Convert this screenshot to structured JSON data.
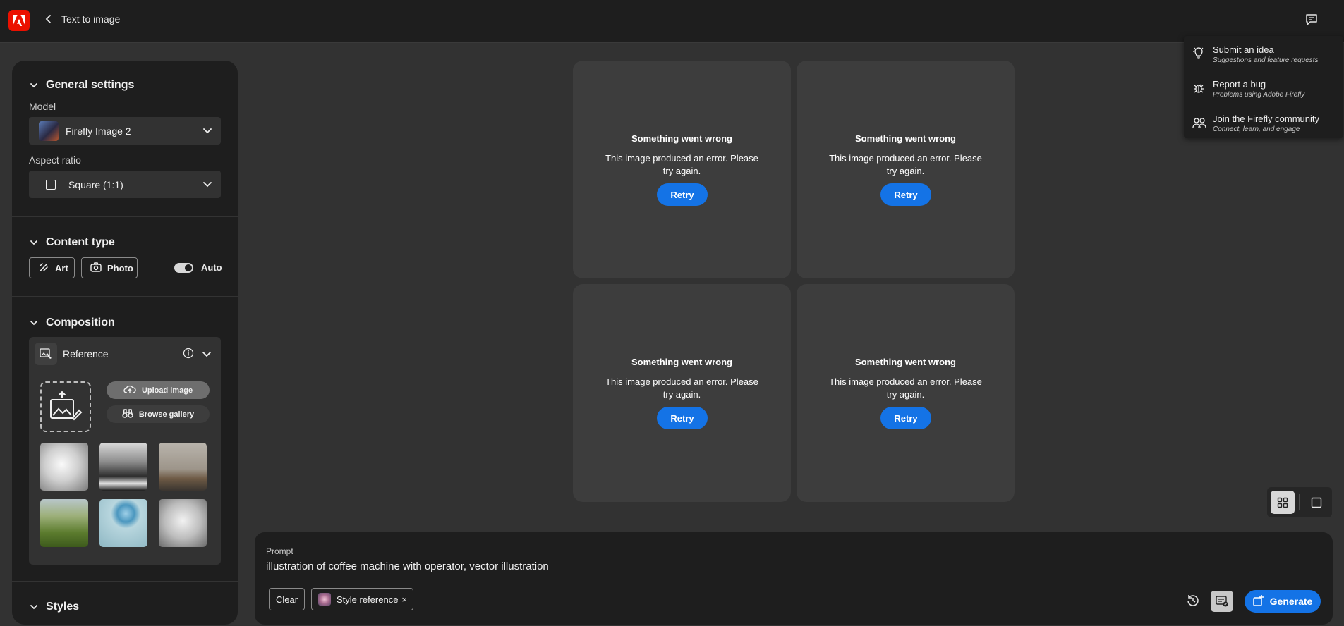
{
  "app": {
    "title": "Text to image",
    "colors": {
      "brand": "#eb1000",
      "accent": "#1473e6",
      "background": "#323232",
      "panel": "#1e1e1e"
    }
  },
  "header": {
    "back_icon": "chevron-left-icon",
    "feedback_icon": "comment-icon"
  },
  "sidebar": {
    "general": {
      "title": "General settings",
      "model_label": "Model",
      "model_value": "Firefly Image 2",
      "aspect_label": "Aspect ratio",
      "aspect_value": "Square (1:1)"
    },
    "content_type": {
      "title": "Content type",
      "art_label": "Art",
      "photo_label": "Photo",
      "auto_label": "Auto",
      "auto_on": true
    },
    "composition": {
      "title": "Composition",
      "reference_label": "Reference",
      "upload_label": "Upload image",
      "browse_label": "Browse gallery",
      "thumbnails": [
        "bird-sketch",
        "mountain-river",
        "living-room",
        "green-field-road",
        "sphere-on-block",
        "owl-sketch"
      ]
    },
    "styles": {
      "title": "Styles"
    }
  },
  "results": {
    "cards": [
      {
        "title": "Something went wrong",
        "message": "This image produced an error. Please try again.",
        "retry": "Retry"
      },
      {
        "title": "Something went wrong",
        "message": "This image produced an error. Please try again.",
        "retry": "Retry"
      },
      {
        "title": "Something went wrong",
        "message": "This image produced an error. Please try again.",
        "retry": "Retry"
      },
      {
        "title": "Something went wrong",
        "message": "This image produced an error. Please try again.",
        "retry": "Retry"
      }
    ]
  },
  "feedback_menu": {
    "items": [
      {
        "title": "Submit an idea",
        "subtitle": "Suggestions and feature requests",
        "icon": "lightbulb-icon"
      },
      {
        "title": "Report a bug",
        "subtitle": "Problems using Adobe Firefly",
        "icon": "bug-icon"
      },
      {
        "title": "Join the Firefly community",
        "subtitle": "Connect, learn, and engage",
        "icon": "community-icon"
      }
    ]
  },
  "view": {
    "grid_icon": "grid-view-icon",
    "single_icon": "single-view-icon",
    "selected": "grid"
  },
  "prompt": {
    "label": "Prompt",
    "value": "illustration of coffee machine with operator, vector illustration",
    "clear_label": "Clear",
    "style_ref_label": "Style reference",
    "remove_symbol": "×",
    "generate_label": "Generate"
  }
}
